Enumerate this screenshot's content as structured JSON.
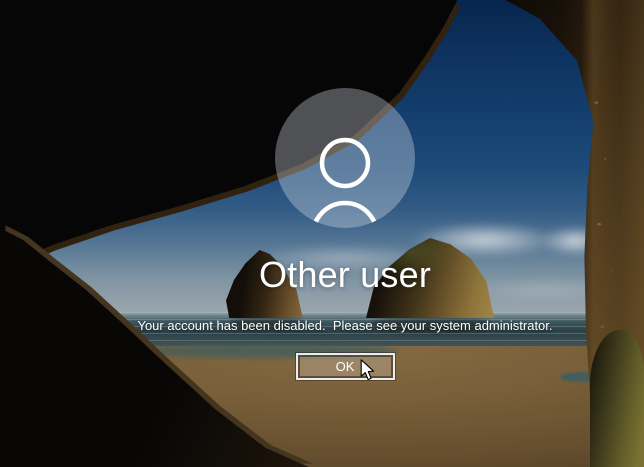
{
  "login": {
    "username": "Other user",
    "message": "Your account has been disabled.  Please see your system administrator.",
    "ok_label": "OK"
  },
  "icons": {
    "avatar": "user-silhouette-icon",
    "cursor": "mouse-arrow-cursor"
  },
  "wallpaper": {
    "description": "Windows hero wallpaper: dark cave silhouette framing a blue sky, two sunlit sea stacks and a sandy beach",
    "colors": {
      "sky_top": "#082a55",
      "sky_horizon": "#b8c3c6",
      "sea": "#32494f",
      "sand": "#8a6c40",
      "cave_rock": "#070605",
      "sunlit_rock": "#7b5d2c"
    }
  },
  "ui_colors": {
    "text": "#ffffff",
    "button_border": "#ececec",
    "avatar_fill": "rgba(222,230,238,0.34)"
  }
}
